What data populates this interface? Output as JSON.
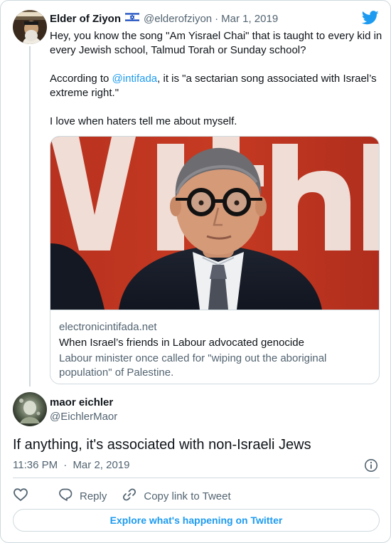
{
  "colors": {
    "accent": "#1d9bf0",
    "secondary_text": "#536471",
    "border": "#cfd9de"
  },
  "original_tweet": {
    "display_name": "Elder of Ziyon",
    "flag_icon": "israel-flag-icon",
    "handle": "@elderofziyon",
    "separator": "·",
    "date": "Mar 1, 2019",
    "avatar_icon": "avatar-elder-of-ziyon",
    "paragraph1": "Hey, you know the song \"Am Yisrael Chai\" that is taught to every kid in every Jewish school, Talmud Torah or Sunday school?",
    "paragraph2_prefix": "According to ",
    "paragraph2_mention": "@intifada",
    "paragraph2_suffix": ", it is  \"a sectarian song associated with Israel’s extreme right.\"",
    "paragraph3": "I love when haters tell me about myself.",
    "card": {
      "image_icon": "news-photo",
      "domain": "electronicintifada.net",
      "title": "When Israel’s friends in Labour advocated genocide",
      "description": "Labour minister once called for \"wiping out the aboriginal population\" of Palestine."
    }
  },
  "reply": {
    "display_name": "maor eichler",
    "handle": "@EichlerMaor",
    "avatar_icon": "avatar-maor-eichler",
    "text": "If anything, it's associated with non-Israeli Jews",
    "time": "11:36 PM",
    "separator": "·",
    "date": "Mar 2, 2019"
  },
  "actions": {
    "like_icon": "heart-icon",
    "reply_label": "Reply",
    "copy_link_label": "Copy link to Tweet"
  },
  "explore_button_label": "Explore what's happening on Twitter",
  "brand_icon": "twitter-bird-icon"
}
